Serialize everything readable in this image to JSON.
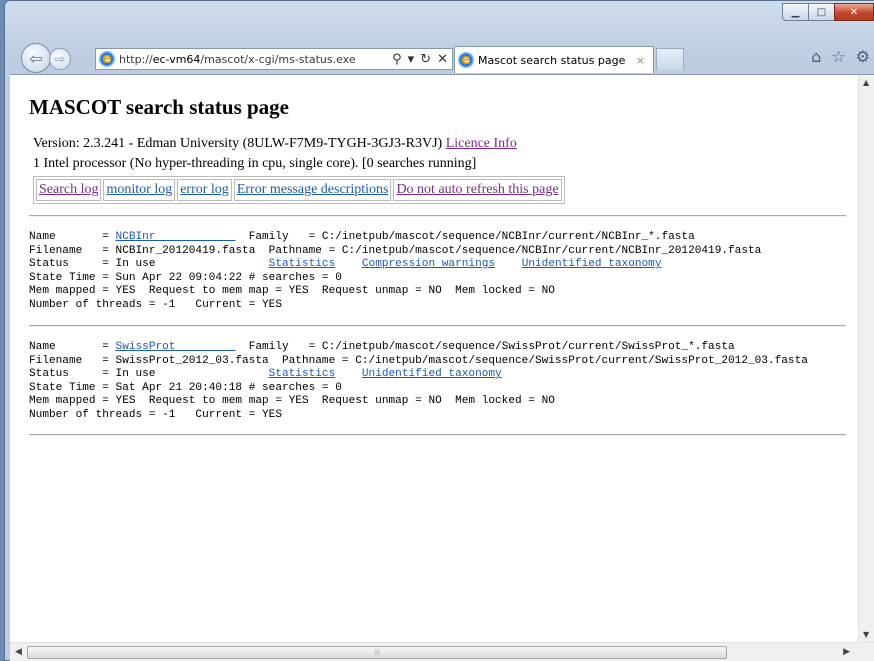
{
  "browser": {
    "url_prefix": "http://",
    "url_host": "ec-vm64",
    "url_path": "/mascot/x-cgi/ms-status.exe",
    "tab_title": "Mascot search status page",
    "tab_close": "×",
    "search_glyph": "⚲",
    "dropdown_glyph": "▾",
    "refresh_glyph": "↻",
    "stop_glyph": "✕",
    "home_glyph": "⌂",
    "favorites_glyph": "☆",
    "tools_glyph": "⚙"
  },
  "window": {
    "minimize": "▁",
    "maximize": "□",
    "close": "✕"
  },
  "page": {
    "title": "MASCOT search status page",
    "version_text": "Version: 2.3.241 - Edman University (8ULW-F7M9-TYGH-3GJ3-R3VJ) ",
    "licence_link": "Licence Info",
    "cpu_text": "1 Intel processor (No hyper-threading in cpu, single core).   [0 searches running]",
    "links": {
      "search_log": "Search log",
      "monitor_log": "monitor log",
      "error_log": "error log",
      "error_descriptions": "Error message descriptions",
      "no_refresh": "Do not auto refresh this page"
    }
  },
  "databases": [
    {
      "name_prefix": "Name       = ",
      "name_link": "NCBInr            ",
      "name_suffix": "  Family   = C:/inetpub/mascot/sequence/NCBInr/current/NCBInr_*.fasta",
      "filename_line": "Filename   = NCBInr_20120419.fasta  Pathname = C:/inetpub/mascot/sequence/NCBInr/current/NCBInr_20120419.fasta",
      "status_prefix": "Status     = In use                 ",
      "statistics": "Statistics",
      "compression": "Compression warnings",
      "taxonomy": "Unidentified taxonomy",
      "state_line": "State Time = Sun Apr 22 09:04:22 # searches = 0",
      "mem_line": "Mem mapped = YES  Request to mem map = YES  Request unmap = NO  Mem locked = NO",
      "threads_line": "Number of threads = -1   Current = YES"
    },
    {
      "name_prefix": "Name       = ",
      "name_link": "SwissProt         ",
      "name_suffix": "  Family   = C:/inetpub/mascot/sequence/SwissProt/current/SwissProt_*.fasta",
      "filename_line": "Filename   = SwissProt_2012_03.fasta  Pathname = C:/inetpub/mascot/sequence/SwissProt/current/SwissProt_2012_03.fasta",
      "status_prefix": "Status     = In use                 ",
      "statistics": "Statistics",
      "taxonomy": "Unidentified taxonomy",
      "state_line": "State Time = Sat Apr 21 20:40:18 # searches = 0",
      "mem_line": "Mem mapped = YES  Request to mem map = YES  Request unmap = NO  Mem locked = NO",
      "threads_line": "Number of threads = -1   Current = YES"
    }
  ],
  "scroll": {
    "thumb_grip": "⦙⦙⦙",
    "up": "▲",
    "down": "▼",
    "left": "◀",
    "right": "▶"
  }
}
